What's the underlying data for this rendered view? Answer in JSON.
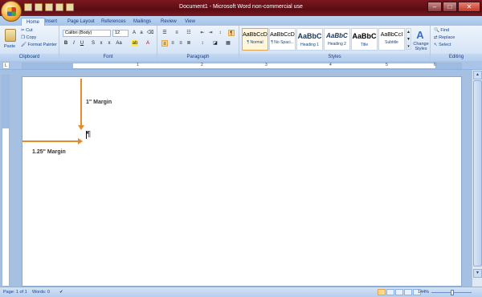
{
  "window": {
    "title": "Document1 - Microsoft Word non-commercial use",
    "buttons": {
      "minimize": "–",
      "maximize": "□",
      "close": "✕"
    }
  },
  "tabs": [
    "Home",
    "Insert",
    "Page Layout",
    "References",
    "Mailings",
    "Review",
    "View"
  ],
  "ribbon": {
    "clipboard": {
      "paste": "Paste",
      "cut": "Cut",
      "copy": "Copy",
      "format_painter": "Format Painter",
      "label": "Clipboard"
    },
    "font": {
      "name": "Calibri (Body)",
      "size": "12",
      "label": "Font"
    },
    "paragraph": {
      "label": "Paragraph"
    },
    "styles": {
      "label": "Styles",
      "items": [
        {
          "sample": "AaBbCcD",
          "name": "¶ Normal"
        },
        {
          "sample": "AaBbCcD",
          "name": "¶ No Spaci..."
        },
        {
          "sample": "AaBbC",
          "name": "Heading 1"
        },
        {
          "sample": "AaBbC",
          "name": "Heading 2"
        },
        {
          "sample": "AaBbC",
          "name": "Title"
        },
        {
          "sample": "AaBbCcI",
          "name": "Subtitle"
        }
      ],
      "change_styles": "Change Styles"
    },
    "editing": {
      "find": "Find",
      "replace": "Replace",
      "select": "Select",
      "label": "Editing"
    }
  },
  "annotations": {
    "top_margin": "1\" Margin",
    "left_margin": "1.25\" Margin"
  },
  "ruler": {
    "numbers": [
      "1",
      "2",
      "3",
      "4",
      "5",
      "6"
    ]
  },
  "status": {
    "page": "Page: 1 of 1",
    "words": "Words: 0",
    "zoom": "144%"
  },
  "colors": {
    "accent_arrow": "#e78a2a",
    "title_bar": "#6b121a",
    "ribbon": "#dbe8f8"
  }
}
